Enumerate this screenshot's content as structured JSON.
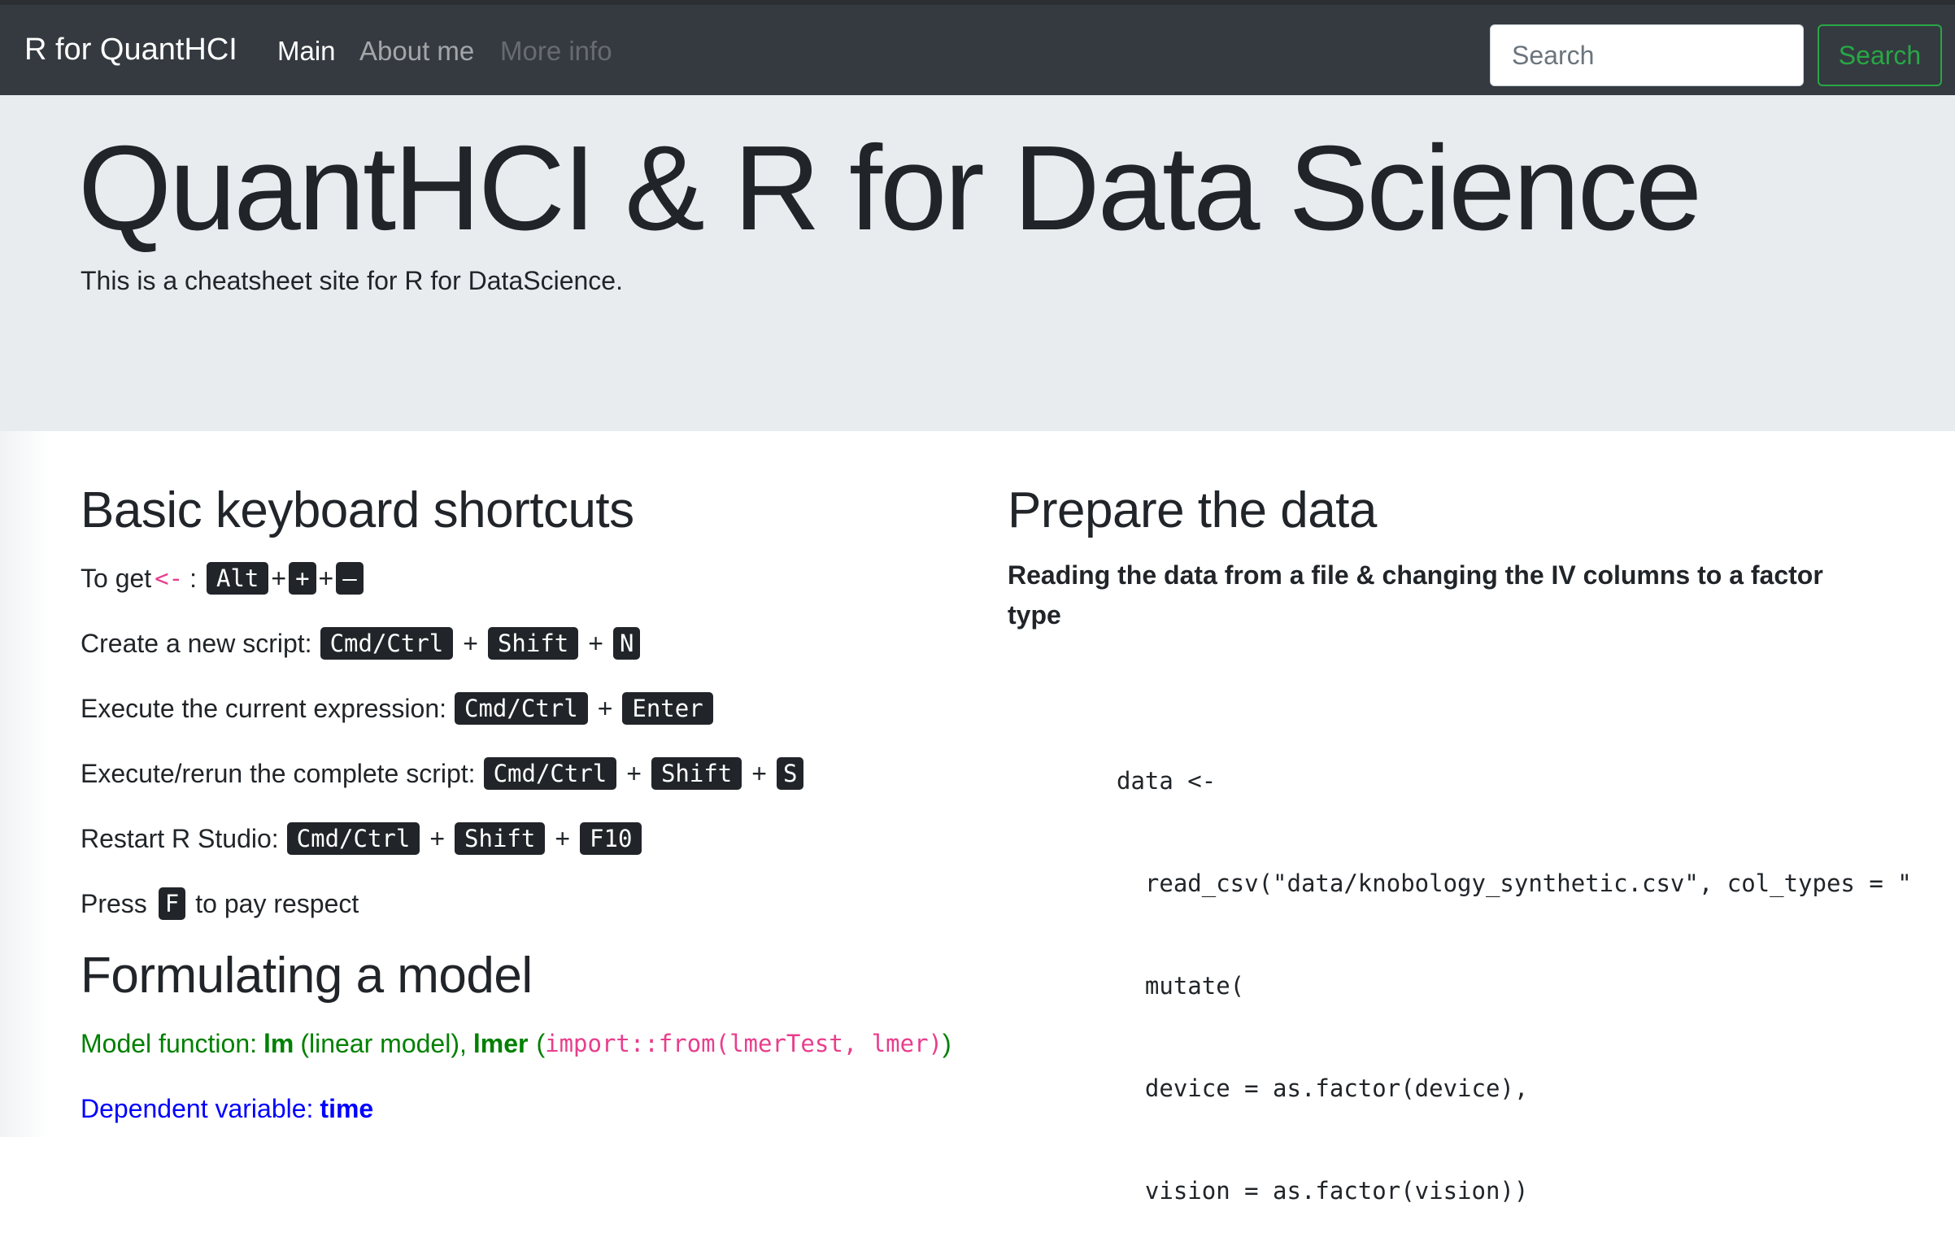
{
  "navbar": {
    "brand": "R for QuantHCI",
    "links": [
      "Main",
      "About me",
      "More info"
    ],
    "search_placeholder": "Search",
    "search_button": "Search"
  },
  "jumbotron": {
    "title": "QuantHCI & R for Data Science",
    "lead": "This is a cheatsheet site for R for DataScience."
  },
  "shortcuts": {
    "heading": "Basic keyboard shortcuts",
    "assign": {
      "label": "To get",
      "operator": "<-",
      "colon": ":",
      "keys": [
        "Alt",
        "+",
        "–"
      ]
    },
    "new_script": {
      "label": "Create a new script:",
      "keys": [
        "Cmd/Ctrl",
        "Shift",
        "N"
      ]
    },
    "exec_expr": {
      "label": "Execute the current expression:",
      "keys": [
        "Cmd/Ctrl",
        "Enter"
      ]
    },
    "exec_script": {
      "label": "Execute/rerun the complete script:",
      "keys": [
        "Cmd/Ctrl",
        "Shift",
        "S"
      ]
    },
    "restart": {
      "label": "Restart R Studio:",
      "keys": [
        "Cmd/Ctrl",
        "Shift",
        "F10"
      ]
    },
    "respect": {
      "before": "Press",
      "key": "F",
      "after": "to pay respect"
    },
    "plus": "+"
  },
  "model": {
    "heading": "Formulating a model",
    "function_line": {
      "label": "Model function:",
      "lm": "lm",
      "lm_desc": "(linear model),",
      "lmer": "lmer",
      "paren_open": "(",
      "import_code": "import::from(lmerTest, lmer)",
      "paren_close": ")"
    },
    "dependent_line": {
      "label": "Dependent variable:",
      "value": "time"
    }
  },
  "prepare": {
    "heading": "Prepare the data",
    "subheading": "Reading the data from a file & changing the IV columns to a factor type",
    "code_lines": [
      "data <-",
      "  read_csv(\"data/knobology_synthetic.csv\", col_types = \"",
      "  mutate(",
      "  device = as.factor(device),",
      "  vision = as.factor(vision))"
    ]
  }
}
